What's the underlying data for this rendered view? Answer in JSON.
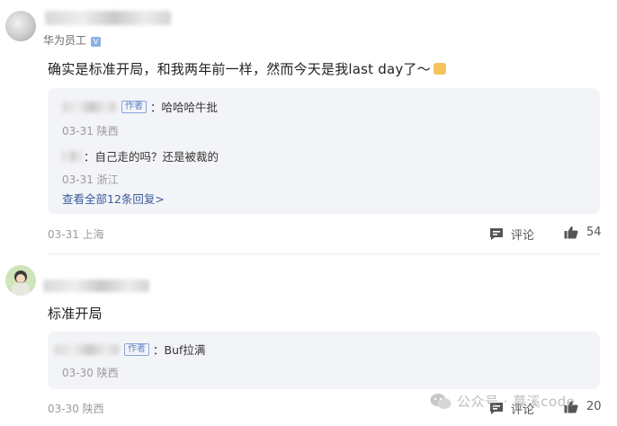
{
  "comments": [
    {
      "user_tag": "华为员工",
      "verified_mark": "V",
      "content": "确实是标准开局，和我两年前一样，然而今天是我last day了～",
      "replies": [
        {
          "author_tag": "作者",
          "text": "：哈哈哈牛批",
          "meta": "03-31 陕西"
        },
        {
          "text": "：自己走的吗？还是被裁的",
          "meta": "03-31 浙江"
        }
      ],
      "view_all": "查看全部12条回复>",
      "meta": "03-31 上海",
      "comment_label": "评论",
      "like_count": "54"
    },
    {
      "content": "标准开局",
      "replies": [
        {
          "author_tag": "作者",
          "text": "：Buf拉满",
          "meta": "03-30 陕西"
        }
      ],
      "meta": "03-30 陕西",
      "comment_label": "评论",
      "like_count": "20"
    }
  ],
  "watermark": "公众号 · 慕溪code",
  "icons": [
    "comment-icon",
    "thumbs-up-icon",
    "wechat-icon"
  ]
}
